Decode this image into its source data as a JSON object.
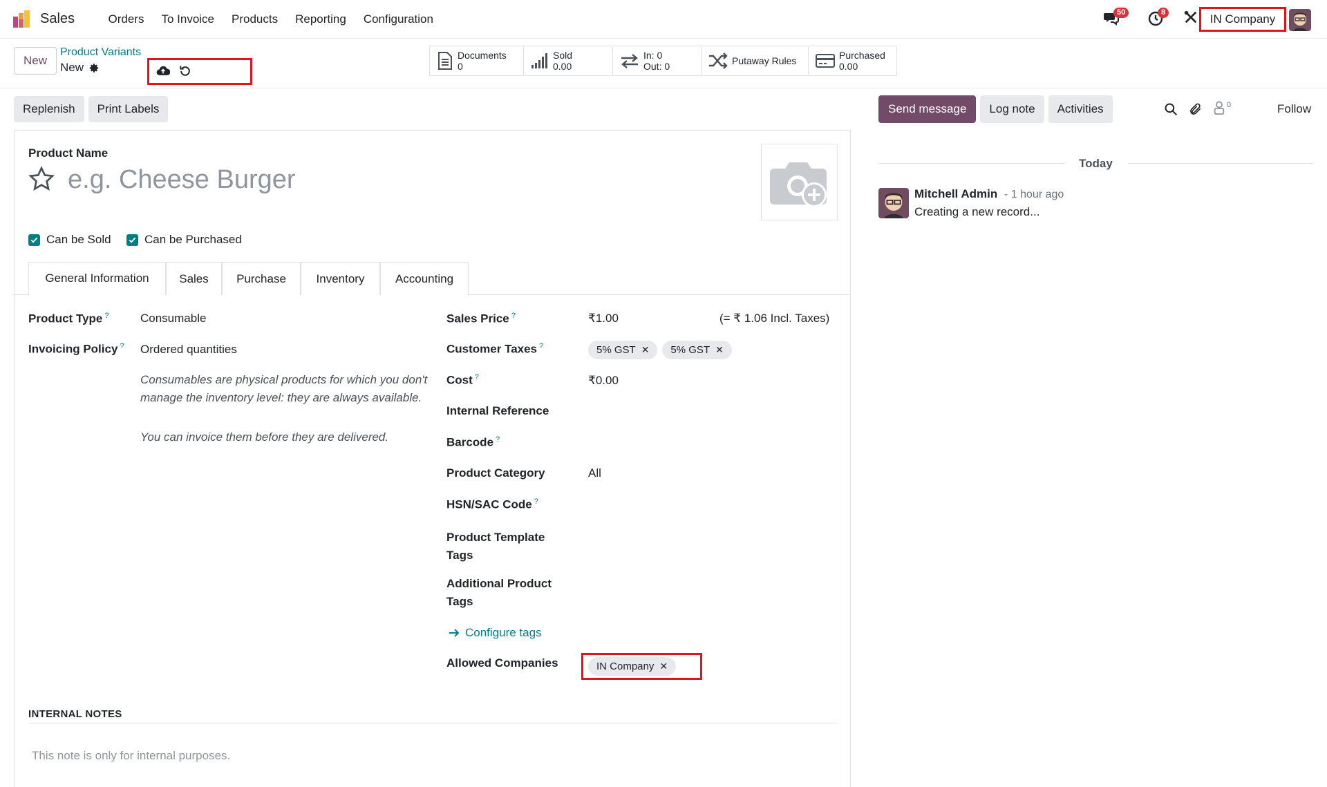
{
  "navbar": {
    "app_name": "Sales",
    "menu": [
      "Orders",
      "To Invoice",
      "Products",
      "Reporting",
      "Configuration"
    ],
    "messages_count": "50",
    "activities_count": "8",
    "company": "IN Company"
  },
  "control_panel": {
    "new_label": "New",
    "breadcrumb_parent": "Product Variants",
    "breadcrumb_current": "New",
    "smart_buttons": [
      {
        "icon": "document-icon",
        "label": "Documents",
        "value": "0"
      },
      {
        "icon": "bar-chart-icon",
        "label": "Sold",
        "value": "0.00"
      },
      {
        "icon": "transfer-icon",
        "label": "In: 0",
        "value": "Out: 0"
      },
      {
        "icon": "shuffle-icon",
        "label": "Putaway Rules",
        "value": ""
      },
      {
        "icon": "credit-card-icon",
        "label": "Purchased",
        "value": "0.00"
      }
    ]
  },
  "actions": {
    "replenish": "Replenish",
    "print_labels": "Print Labels"
  },
  "form": {
    "product_name_label": "Product Name",
    "product_name_placeholder": "e.g. Cheese Burger",
    "can_be_sold": "Can be Sold",
    "can_be_purchased": "Can be Purchased",
    "tabs": [
      "General Information",
      "Sales",
      "Purchase",
      "Inventory",
      "Accounting"
    ],
    "left": {
      "product_type_label": "Product Type",
      "product_type_value": "Consumable",
      "invoicing_policy_label": "Invoicing Policy",
      "invoicing_policy_value": "Ordered quantities",
      "help_1": "Consumables are physical products for which you don't manage the inventory level: they are always available.",
      "help_2": "You can invoice them before they are delivered."
    },
    "right": {
      "sales_price_label": "Sales Price",
      "sales_price_value": "₹1.00",
      "sales_price_incl": "(= ₹ 1.06 Incl. Taxes)",
      "customer_taxes_label": "Customer Taxes",
      "customer_taxes": [
        "5% GST",
        "5% GST"
      ],
      "cost_label": "Cost",
      "cost_value": "₹0.00",
      "internal_ref_label": "Internal Reference",
      "barcode_label": "Barcode",
      "category_label": "Product Category",
      "category_value": "All",
      "hsn_label": "HSN/SAC Code",
      "template_tags_label_1": "Product Template",
      "template_tags_label_2": "Tags",
      "additional_tags_label_1": "Additional Product",
      "additional_tags_label_2": "Tags",
      "configure_tags": "Configure tags",
      "allowed_companies_label": "Allowed Companies",
      "allowed_company_tag": "IN Company"
    },
    "notes_title": "INTERNAL NOTES",
    "notes_placeholder": "This note is only for internal purposes."
  },
  "chatter": {
    "send_message": "Send message",
    "log_note": "Log note",
    "activities": "Activities",
    "followers_count": "0",
    "follow": "Follow",
    "today": "Today",
    "message": {
      "author": "Mitchell Admin",
      "time": "- 1 hour ago",
      "body": "Creating a new record..."
    }
  },
  "colors": {
    "primary": "#714b67",
    "accent": "#017e84",
    "highlight": "#e3121b"
  }
}
